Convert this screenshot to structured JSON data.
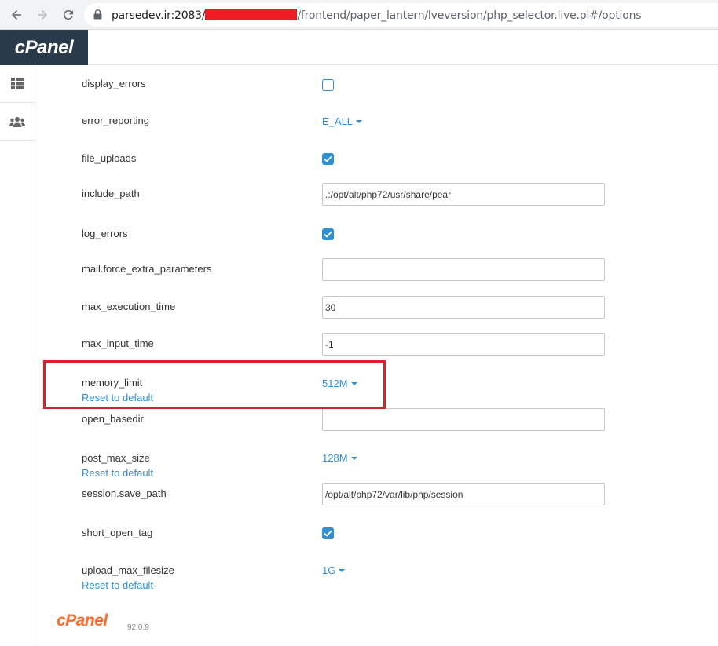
{
  "browser": {
    "url_host": "parsedev.ir:2083/",
    "url_path": "/frontend/paper_lantern/lveversion/php_selector.live.pl#/options"
  },
  "header": {
    "logo": "cPanel"
  },
  "sidebar": {
    "items": [
      {
        "icon": "grid-icon"
      },
      {
        "icon": "users-icon"
      }
    ]
  },
  "options": {
    "display_errors": {
      "label": "display_errors",
      "checked": false
    },
    "error_reporting": {
      "label": "error_reporting",
      "value": "E_ALL"
    },
    "file_uploads": {
      "label": "file_uploads",
      "checked": true
    },
    "include_path": {
      "label": "include_path",
      "value": ".:/opt/alt/php72/usr/share/pear"
    },
    "log_errors": {
      "label": "log_errors",
      "checked": true
    },
    "mail_force_extra_parameters": {
      "label": "mail.force_extra_parameters",
      "value": ""
    },
    "max_execution_time": {
      "label": "max_execution_time",
      "value": "30"
    },
    "max_input_time": {
      "label": "max_input_time",
      "value": "-1"
    },
    "memory_limit": {
      "label": "memory_limit",
      "value": "512M",
      "reset": "Reset to default"
    },
    "open_basedir": {
      "label": "open_basedir",
      "value": ""
    },
    "post_max_size": {
      "label": "post_max_size",
      "value": "128M",
      "reset": "Reset to default"
    },
    "session_save_path": {
      "label": "session.save_path",
      "value": "/opt/alt/php72/var/lib/php/session"
    },
    "short_open_tag": {
      "label": "short_open_tag",
      "checked": true
    },
    "upload_max_filesize": {
      "label": "upload_max_filesize",
      "value": "1G",
      "reset": "Reset to default"
    }
  },
  "footer": {
    "logo": "cPanel",
    "version": "92.0.9"
  },
  "colors": {
    "accent": "#2c8fd8",
    "highlight": "#d8232a",
    "header_bg": "#293a4a",
    "footer_logo": "#ff6c2c"
  }
}
